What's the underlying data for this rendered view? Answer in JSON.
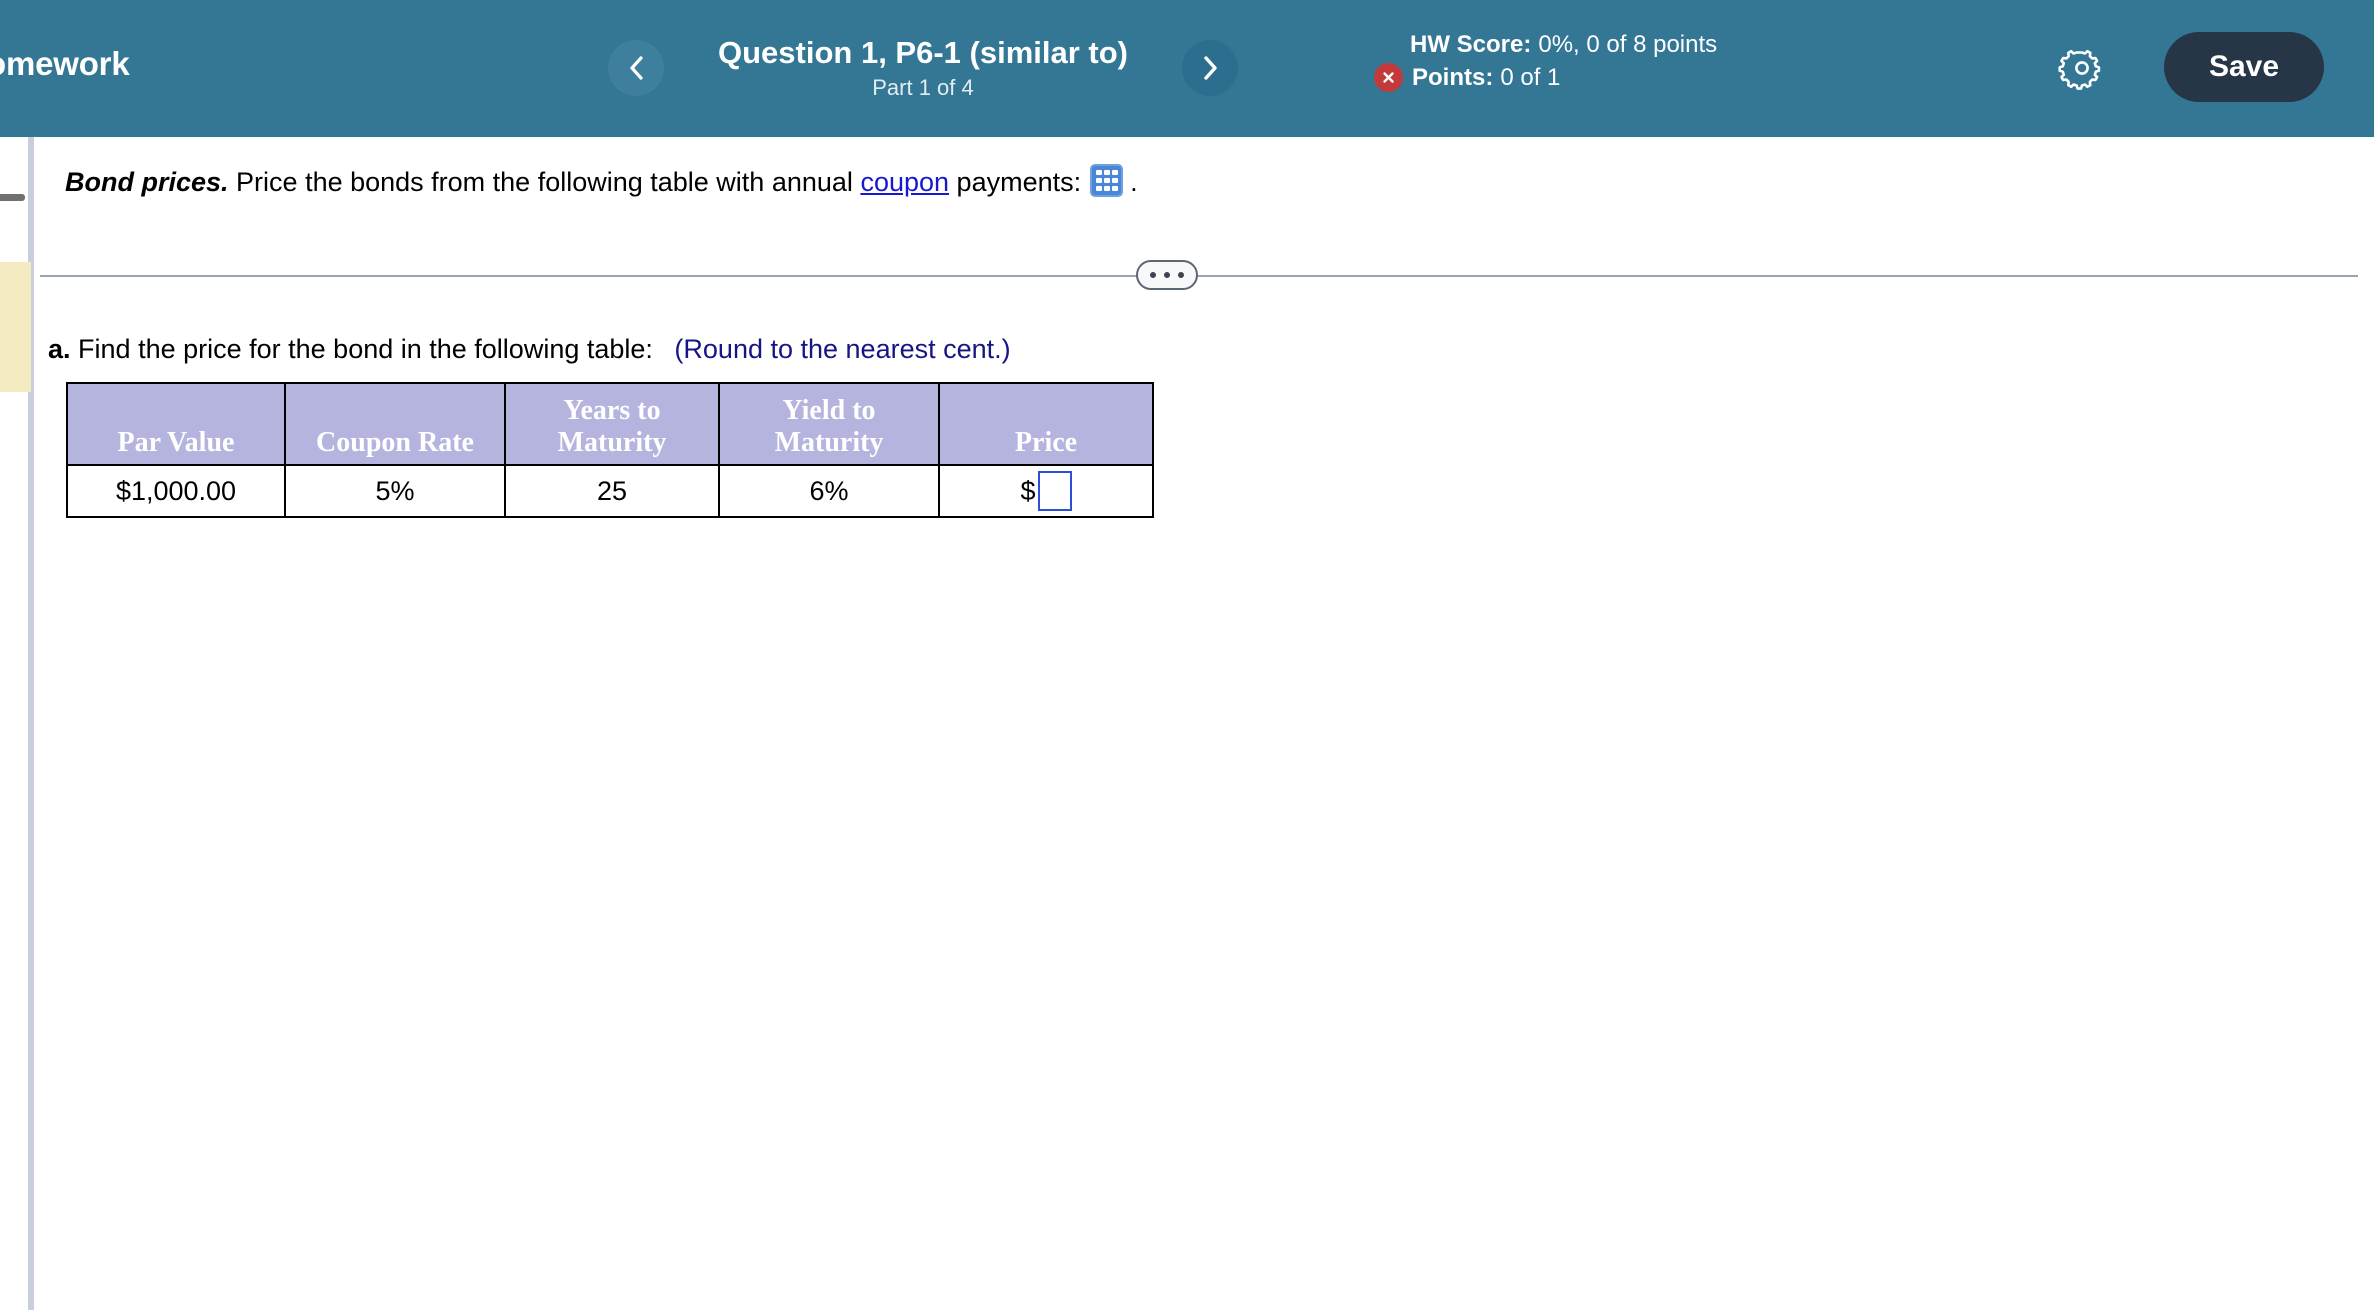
{
  "header": {
    "app_title": "omework",
    "question_title": "Question 1, P6-1 (similar to)",
    "part_label": "Part 1 of 4",
    "prev_icon": "chevron-left-icon",
    "next_icon": "chevron-right-icon",
    "hw_score_label": "HW Score:",
    "hw_score_value": "0%, 0 of 8 points",
    "points_label": "Points:",
    "points_value": "0 of 1",
    "points_status_icon": "error-x-icon",
    "gear_icon": "gear-icon",
    "save_label": "Save",
    "bar_color": "#337795",
    "save_color": "#263646",
    "error_color": "#c33a3a"
  },
  "question": {
    "lead_in": "Bond prices.",
    "body_before_link": "Price the bonds from the following table with annual",
    "link_text": "coupon",
    "body_after_link": "payments:",
    "trailing_period": ".",
    "grid_icon": "table-grid-icon"
  },
  "divider": {
    "dots_icon": "ellipsis-expand-icon"
  },
  "part": {
    "label": "a.",
    "prompt": "Find the price for the bond in the following table:",
    "round_note": "(Round to the nearest cent.)"
  },
  "table": {
    "headers": [
      "Par Value",
      "Coupon Rate",
      "Years to Maturity",
      "Yield to Maturity",
      "Price"
    ],
    "headers_split": [
      {
        "line1": "Par Value",
        "line2": ""
      },
      {
        "line1": "Coupon Rate",
        "line2": ""
      },
      {
        "line1": "Years to",
        "line2": "Maturity"
      },
      {
        "line1": "Yield to",
        "line2": "Maturity"
      },
      {
        "line1": "Price",
        "line2": ""
      }
    ],
    "row": {
      "par_value": "$1,000.00",
      "coupon_rate": "5%",
      "years_to_maturity": "25",
      "yield_to_maturity": "6%",
      "price_prefix": "$",
      "price_value": "",
      "price_placeholder": ""
    },
    "header_bg": "#b4b4de",
    "input_border": "#2c4fd8"
  },
  "rail": {
    "handle_icon": "collapse-handle-icon",
    "highlight_color": "#f4ebc2"
  }
}
